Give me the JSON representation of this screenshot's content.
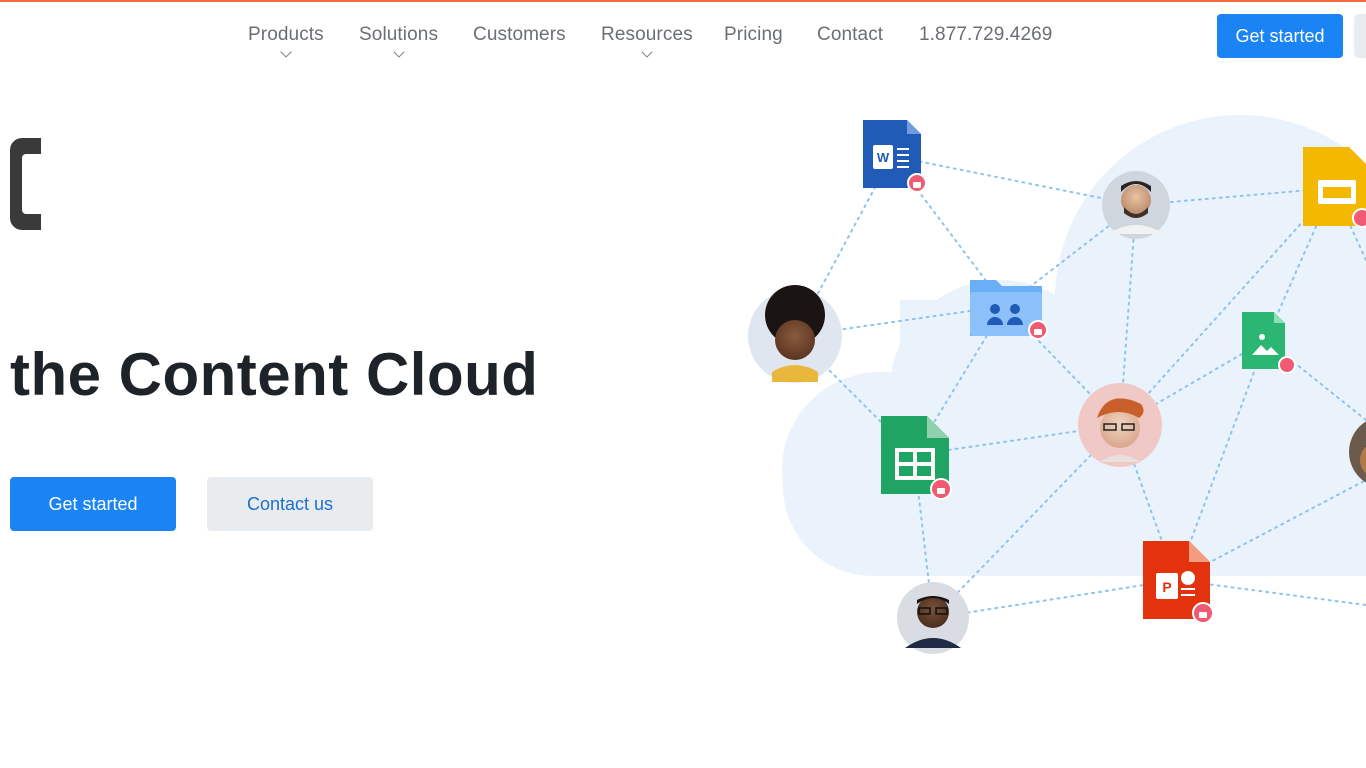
{
  "colors": {
    "accent_bar": "#f26b3a",
    "primary": "#1a84f4",
    "secondary_bg": "#e8ecef",
    "headline": "#1d2328"
  },
  "nav": {
    "items": [
      {
        "label": "Products",
        "has_dropdown": true
      },
      {
        "label": "Solutions",
        "has_dropdown": true
      },
      {
        "label": "Customers",
        "has_dropdown": false
      },
      {
        "label": "Resources",
        "has_dropdown": true
      },
      {
        "label": "Pricing",
        "has_dropdown": false
      },
      {
        "label": "Contact",
        "has_dropdown": false
      }
    ],
    "phone": "1.877.729.4269",
    "cta": "Get started"
  },
  "hero": {
    "headline": "the Content Cloud",
    "primary_button": "Get started",
    "secondary_button": "Contact us"
  },
  "illustration": {
    "nodes": [
      {
        "type": "word-doc-icon",
        "letter": "W"
      },
      {
        "type": "slides-icon"
      },
      {
        "type": "shared-folder-icon"
      },
      {
        "type": "image-file-icon"
      },
      {
        "type": "sheets-icon"
      },
      {
        "type": "powerpoint-icon",
        "letter": "P"
      },
      {
        "type": "avatar-man-beard"
      },
      {
        "type": "avatar-woman-curly"
      },
      {
        "type": "avatar-man-redhair"
      },
      {
        "type": "avatar-man-glasses"
      },
      {
        "type": "avatar-partial"
      }
    ]
  }
}
